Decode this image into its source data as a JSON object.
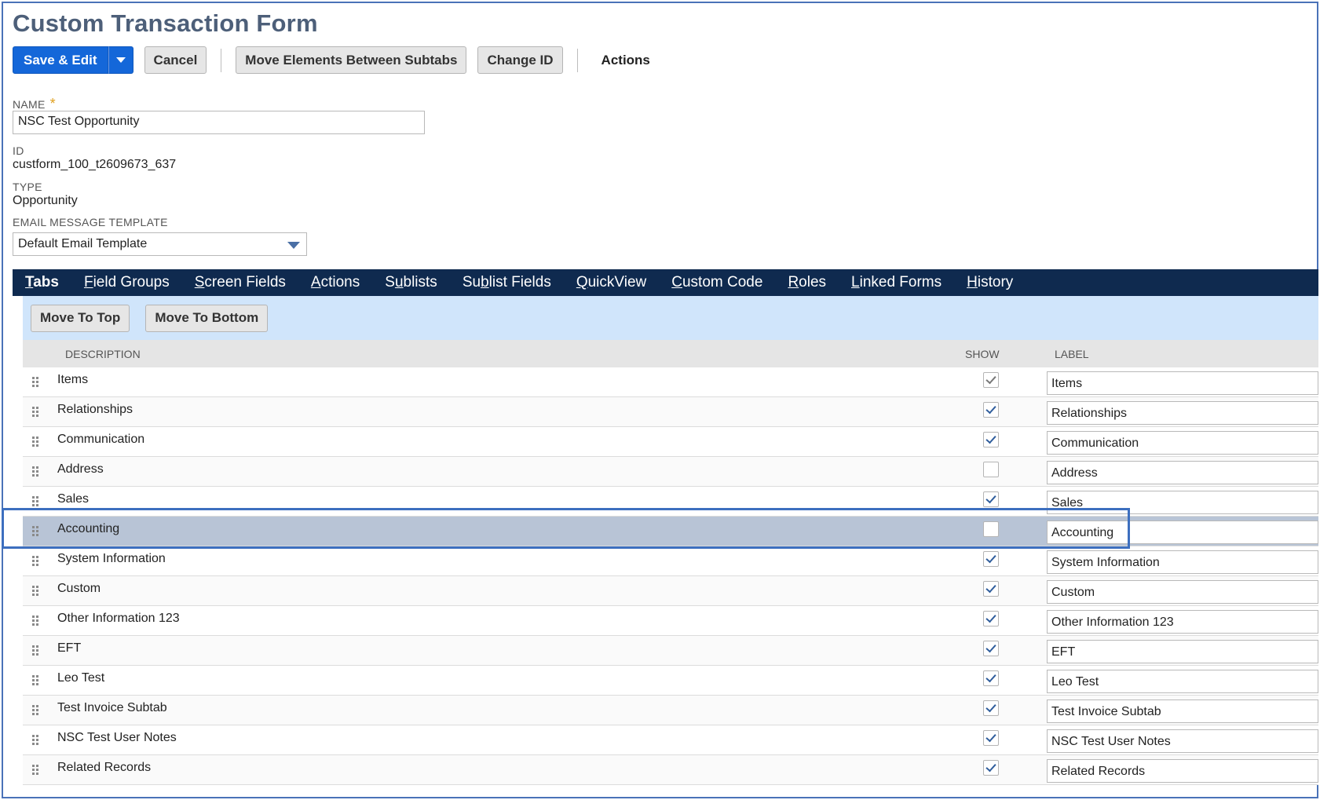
{
  "page": {
    "title": "Custom Transaction Form"
  },
  "toolbar": {
    "save_label": "Save & Edit",
    "cancel_label": "Cancel",
    "move_label": "Move Elements Between Subtabs",
    "change_id_label": "Change ID",
    "actions_label": "Actions"
  },
  "form": {
    "name_label": "NAME",
    "name_value": "NSC Test Opportunity",
    "id_label": "ID",
    "id_value": "custform_100_t2609673_637",
    "type_label": "TYPE",
    "type_value": "Opportunity",
    "email_label": "EMAIL MESSAGE TEMPLATE",
    "email_value": "Default Email Template"
  },
  "tabs": [
    {
      "u": "T",
      "rest": "abs",
      "pre": ""
    },
    {
      "pre": "",
      "u": "F",
      "rest": "ield Groups"
    },
    {
      "pre": "",
      "u": "S",
      "rest": "creen Fields"
    },
    {
      "pre": "",
      "u": "A",
      "rest": "ctions"
    },
    {
      "pre": "S",
      "u": "u",
      "rest": "blists"
    },
    {
      "pre": "Su",
      "u": "b",
      "rest": "list Fields"
    },
    {
      "pre": "",
      "u": "Q",
      "rest": "uickView"
    },
    {
      "pre": "",
      "u": "C",
      "rest": "ustom Code"
    },
    {
      "pre": "",
      "u": "R",
      "rest": "oles"
    },
    {
      "pre": "",
      "u": "L",
      "rest": "inked Forms"
    },
    {
      "pre": "",
      "u": "H",
      "rest": "istory"
    }
  ],
  "subtoolbar": {
    "move_top_label": "Move To Top",
    "move_bottom_label": "Move To Bottom"
  },
  "grid": {
    "headers": {
      "description": "DESCRIPTION",
      "show": "SHOW",
      "label": "LABEL"
    },
    "rows": [
      {
        "description": "Items",
        "show": true,
        "disabled": true,
        "label": "Items"
      },
      {
        "description": "Relationships",
        "show": true,
        "label": "Relationships"
      },
      {
        "description": "Communication",
        "show": true,
        "label": "Communication"
      },
      {
        "description": "Address",
        "show": false,
        "label": "Address"
      },
      {
        "description": "Sales",
        "show": true,
        "label": "Sales"
      },
      {
        "description": "Accounting",
        "show": false,
        "label": "Accounting",
        "selected": true
      },
      {
        "description": "System Information",
        "show": true,
        "label": "System Information"
      },
      {
        "description": "Custom",
        "show": true,
        "label": "Custom"
      },
      {
        "description": "Other Information 123",
        "show": true,
        "label": "Other Information 123"
      },
      {
        "description": "EFT",
        "show": true,
        "label": "EFT"
      },
      {
        "description": "Leo Test",
        "show": true,
        "label": "Leo Test"
      },
      {
        "description": "Test Invoice Subtab",
        "show": true,
        "label": "Test Invoice Subtab"
      },
      {
        "description": "NSC Test User Notes",
        "show": true,
        "label": "NSC Test User Notes"
      },
      {
        "description": "Related Records",
        "show": true,
        "label": "Related Records"
      }
    ]
  }
}
